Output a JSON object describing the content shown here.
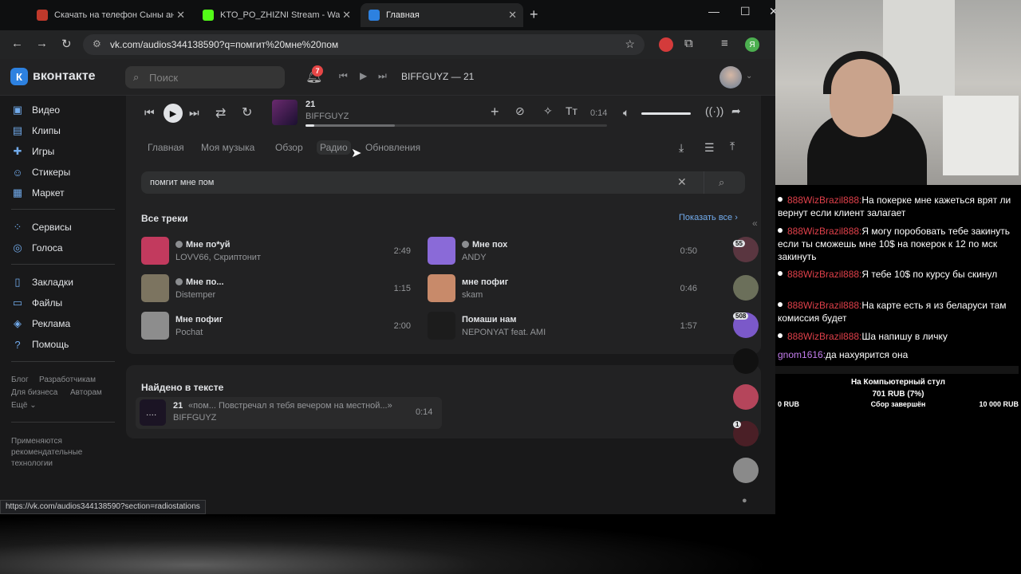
{
  "browser": {
    "tabs": [
      {
        "label": "Скачать на телефон Сыны ана",
        "active": false
      },
      {
        "label": "KTO_PO_ZHIZNI Stream - Watc",
        "active": false
      },
      {
        "label": "Главная",
        "active": true
      }
    ],
    "url": "vk.com/audios344138590?q=помгит%20мне%20пом",
    "profile_letter": "Я",
    "status_url": "https://vk.com/audios344138590?section=radiostations"
  },
  "vk": {
    "logo": "вконтакте",
    "search_placeholder": "Поиск",
    "notifications": "7",
    "header_track": "BIFFGUYZ — 21",
    "nav": [
      {
        "label": "Видео",
        "icon": "video-icon"
      },
      {
        "label": "Клипы",
        "icon": "clips-icon"
      },
      {
        "label": "Игры",
        "icon": "games-icon"
      },
      {
        "label": "Стикеры",
        "icon": "stickers-icon"
      },
      {
        "label": "Маркет",
        "icon": "market-icon"
      },
      {
        "label": "Сервисы",
        "icon": "services-icon"
      },
      {
        "label": "Голоса",
        "icon": "votes-icon"
      },
      {
        "label": "Закладки",
        "icon": "bookmarks-icon"
      },
      {
        "label": "Файлы",
        "icon": "files-icon"
      },
      {
        "label": "Реклама",
        "icon": "ads-icon"
      },
      {
        "label": "Помощь",
        "icon": "help-icon"
      }
    ],
    "footer": {
      "blog": "Блог",
      "dev": "Разработчикам",
      "business": "Для бизнеса",
      "authors": "Авторам",
      "more": "Ещё ⌄",
      "recommend": "Применяются рекомендательные технологии"
    },
    "player": {
      "title": "21",
      "artist": "BIFFGUYZ",
      "time": "0:14",
      "progress": 0.03,
      "volume": 1.0
    },
    "tabs": [
      {
        "label": "Главная",
        "selected": false
      },
      {
        "label": "Моя музыка",
        "selected": false
      },
      {
        "label": "Обзор",
        "selected": false
      },
      {
        "label": "Радио",
        "selected": true
      },
      {
        "label": "Обновления",
        "selected": false
      }
    ],
    "query": "помгит мне пом",
    "all_tracks_title": "Все треки",
    "show_all": "Показать все",
    "tracks": [
      {
        "title": "Мне по*уй",
        "artist": "LOVV66, Скриптонит",
        "duration": "2:49",
        "explicit": true,
        "cover": "#c23a5e"
      },
      {
        "title": "Мне пох",
        "artist": "ANDY",
        "duration": "0:50",
        "explicit": true,
        "cover": "#8a6ad8"
      },
      {
        "title": "Мне по...",
        "artist": "Distemper",
        "duration": "1:15",
        "explicit": true,
        "cover": "#7c7460"
      },
      {
        "title": "мне пофиг",
        "artist": "skam",
        "duration": "0:46",
        "explicit": false,
        "cover": "#c88a6a"
      },
      {
        "title": "Мне пофиг",
        "artist": "Pochat",
        "duration": "2:00",
        "explicit": false,
        "cover": "#8d8d8d"
      },
      {
        "title": "Помаши нам",
        "artist": "NEPONYAT feat. AMI",
        "duration": "1:57",
        "explicit": false,
        "cover": "#1c1c1c"
      }
    ],
    "lyrics_title": "Найдено в тексте",
    "lyrics_track": {
      "title": "21",
      "snippet": "«пом... Повстречал я тебя вечером на местной...»",
      "artist": "BIFFGUYZ",
      "duration": "0:14"
    },
    "side_badges": [
      "55",
      "508",
      "1"
    ]
  },
  "chat": [
    {
      "user": "888WizBrazil888:",
      "text": "На покерке мне кажеться врят ли вернут если клиент залагает"
    },
    {
      "user": "888WizBrazil888:",
      "text": "Я могу поробовать тебе закинуть если ты сможешь мне 10$ на покерок к 12 по мск закинуть"
    },
    {
      "user": "888WizBrazil888:",
      "text": "Я тебе 10$ по курсу бы скинул"
    },
    {
      "user": "888WizBrazil888:",
      "text": "На карте есть я из беларуси там комиссия будет"
    },
    {
      "user": "888WizBrazil888:",
      "text": "Ша напишу в личку"
    },
    {
      "user": "gnom1616:",
      "text": "да нахуярится она"
    }
  ],
  "goal": {
    "title": "На Компьютерный стул",
    "amount": "701 RUB (7%)",
    "min": "0 RUB",
    "status": "Сбор завершён",
    "max": "10 000 RUB"
  },
  "colors": {
    "accent": "#71aaeb",
    "chat_user": "#e0404a",
    "chat_user2": "#c57ef0"
  }
}
